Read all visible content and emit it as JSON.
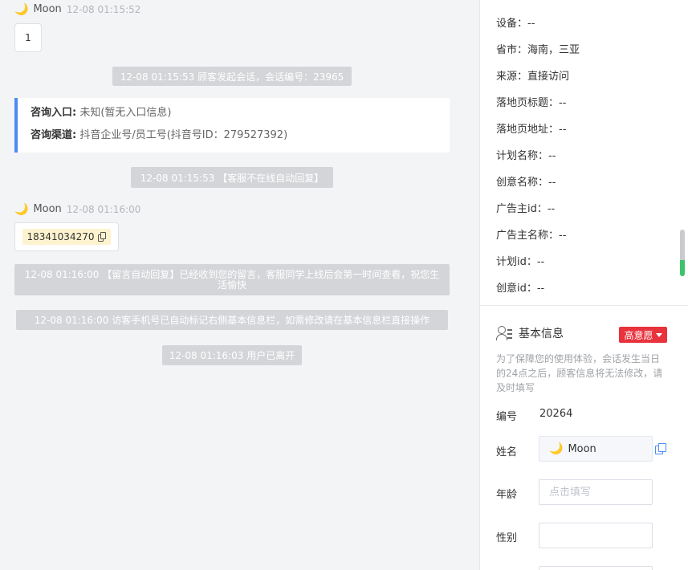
{
  "chat": {
    "messages": [
      {
        "sender": "Moon",
        "time": "12-08 01:15:52",
        "text": "1"
      },
      {
        "sender": "Moon",
        "time": "12-08 01:16:00",
        "text": "18341034270"
      }
    ],
    "system": [
      "12-08 01:15:53 顾客发起会话，会话编号：23965",
      "12-08 01:15:53 【客服不在线自动回复】",
      "12-08 01:16:00 【留言自动回复】已经收到您的留言，客服同学上线后会第一时间查看，祝您生活愉快",
      "12-08 01:16:00 访客手机号已自动标记右侧基本信息栏，如需修改请在基本信息栏直接操作",
      "12-08 01:16:03 用户已离开"
    ],
    "entry": {
      "entrance_label": "咨询入口:",
      "entrance_value": "未知(暂无入口信息)",
      "channel_label": "咨询渠道:",
      "channel_value": "抖音企业号/员工号(抖音号ID：279527392)"
    }
  },
  "panel": {
    "source_info": [
      "设备：--",
      "省市：海南，三亚",
      "来源：直接访问",
      "落地页标题：--",
      "落地页地址：--",
      "计划名称：--",
      "创意名称：--",
      "广告主id：--",
      "广告主名称：--",
      "计划id：--",
      "创意id：--"
    ],
    "basic": {
      "title": "基本信息",
      "intent_badge": "高意愿",
      "notice": "为了保障您的使用体验，会话发生当日的24点之后，顾客信息将无法修改，请及时填写",
      "id_label": "编号",
      "id_value": "20264",
      "name_label": "姓名",
      "name_value": "Moon",
      "age_label": "年龄",
      "age_placeholder": "点击填写",
      "gender_label": "性别"
    }
  },
  "colors": {
    "accent": "#4a8cf5",
    "badge": "#e8323c",
    "phone_highlight": "#fdf3cf",
    "system_bg": "#d4d5d8"
  },
  "icons": [
    "moon-icon",
    "copy-icon",
    "user-list-icon",
    "caret-down-icon"
  ]
}
